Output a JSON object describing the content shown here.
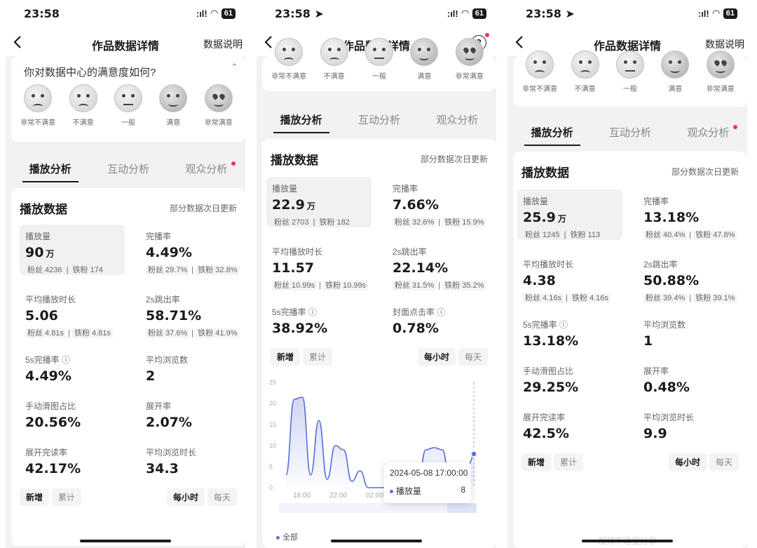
{
  "screens": [
    {
      "status_time": "23:58",
      "signal": ":ıl!",
      "battery": "61",
      "nav_title": "作品数据详情",
      "nav_help": "数据说明",
      "survey_question": "你对数据中心的满意度如何?",
      "emoji_labels": [
        "非常不满意",
        "不满意",
        "一般",
        "满意",
        "非常满意"
      ],
      "tabs": [
        "播放分析",
        "互动分析",
        "观众分析"
      ],
      "card_title": "播放数据",
      "card_note": "部分数据次日更新",
      "metrics": [
        {
          "label": "播放量",
          "value": "90",
          "unit": "万",
          "sub_fans": "粉丝 4236",
          "sub_iron": "铁粉 174"
        },
        {
          "label": "完播率",
          "value": "4.49%",
          "unit": "",
          "sub_fans": "粉丝 29.7%",
          "sub_iron": "铁粉 32.8%"
        },
        {
          "label": "平均播放时长",
          "value": "5.06",
          "unit": "",
          "sub_fans": "粉丝 4.81s",
          "sub_iron": "铁粉 4.81s"
        },
        {
          "label": "2s跳出率",
          "value": "58.71%",
          "unit": "",
          "sub_fans": "粉丝 37.6%",
          "sub_iron": "铁粉 41.9%"
        },
        {
          "label": "5s完播率 ⓘ",
          "value": "4.49%"
        },
        {
          "label": "平均浏览数",
          "value": "2"
        },
        {
          "label": "手动滑图占比",
          "value": "20.56%"
        },
        {
          "label": "展开率",
          "value": "2.07%"
        },
        {
          "label": "展开完读率",
          "value": "42.17%"
        },
        {
          "label": "平均浏览时长",
          "value": "34.3"
        }
      ],
      "buttons": {
        "new": "新增",
        "cumulative": "累计",
        "hourly": "每小时",
        "daily": "每天"
      }
    },
    {
      "status_time": "23:58",
      "signal": ":ıl!",
      "battery": "61",
      "nav_title": "作品数据详情",
      "nav_help_symbol": "?",
      "emoji_labels": [
        "非常不满意",
        "不满意",
        "一般",
        "满意",
        "非常满意"
      ],
      "tabs": [
        "播放分析",
        "互动分析",
        "观众分析"
      ],
      "card_title": "播放数据",
      "card_note": "部分数据次日更新",
      "metrics": [
        {
          "label": "播放量",
          "value": "22.9",
          "unit": "万",
          "sub_fans": "粉丝 2703",
          "sub_iron": "铁粉 182"
        },
        {
          "label": "完播率",
          "value": "7.66%",
          "unit": "",
          "sub_fans": "粉丝 32.6%",
          "sub_iron": "铁粉 15.9%"
        },
        {
          "label": "平均播放时长",
          "value": "11.57",
          "unit": "",
          "sub_fans": "粉丝 10.99s",
          "sub_iron": "铁粉 10.99s"
        },
        {
          "label": "2s跳出率",
          "value": "22.14%",
          "unit": "",
          "sub_fans": "粉丝 31.5%",
          "sub_iron": "铁粉 35.2%"
        },
        {
          "label": "5s完播率 ⓘ",
          "value": "38.92%"
        },
        {
          "label": "封面点击率 ⓘ",
          "value": "0.78%"
        }
      ],
      "buttons": {
        "new": "新增",
        "cumulative": "累计",
        "hourly": "每小时",
        "daily": "每天"
      },
      "tooltip": {
        "date": "2024-05-08 17:00:00",
        "series": "播放量",
        "value": "8"
      },
      "legend": "全部"
    },
    {
      "status_time": "23:58",
      "signal": ":ıl!",
      "battery": "61",
      "nav_title": "作品数据详情",
      "nav_help": "数据说明",
      "emoji_labels": [
        "非常不满意",
        "不满意",
        "一般",
        "满意",
        "非常满意"
      ],
      "tabs": [
        "播放分析",
        "互动分析",
        "观众分析"
      ],
      "card_title": "播放数据",
      "card_note": "部分数据次日更新",
      "metrics": [
        {
          "label": "播放量",
          "value": "25.9",
          "unit": "万",
          "sub_fans": "粉丝 1245",
          "sub_iron": "铁粉 113"
        },
        {
          "label": "完播率",
          "value": "13.18%",
          "unit": "",
          "sub_fans": "粉丝 40.4%",
          "sub_iron": "铁粉 47.8%"
        },
        {
          "label": "平均播放时长",
          "value": "4.38",
          "unit": "",
          "sub_fans": "粉丝 4.16s",
          "sub_iron": "铁粉 4.16s"
        },
        {
          "label": "2s跳出率",
          "value": "50.88%",
          "unit": "",
          "sub_fans": "粉丝 39.4%",
          "sub_iron": "铁粉 39.1%"
        },
        {
          "label": "5s完播率 ⓘ",
          "value": "13.18%"
        },
        {
          "label": "平均浏览数",
          "value": "1"
        },
        {
          "label": "手动滑图占比",
          "value": "29.25%"
        },
        {
          "label": "展开率",
          "value": "0.48%"
        },
        {
          "label": "展开完读率",
          "value": "42.5%"
        },
        {
          "label": "平均浏览时长",
          "value": "9.9"
        }
      ],
      "buttons": {
        "new": "新增",
        "cumulative": "累计",
        "hourly": "每小时",
        "daily": "每天"
      },
      "faded_text": "视频不适宜分享"
    }
  ],
  "chart_data": {
    "type": "area",
    "title": "",
    "xlabel": "",
    "ylabel": "",
    "x_ticks": [
      "18:00",
      "22:00",
      "02:00"
    ],
    "y_ticks": [
      0,
      5,
      10,
      15,
      20,
      25
    ],
    "ylim": [
      0,
      25
    ],
    "series": [
      {
        "name": "播放量",
        "x_hours": [
          0,
          1,
          2,
          3,
          4,
          5,
          6,
          7,
          8,
          9,
          10,
          11,
          12,
          13,
          14,
          15,
          16,
          17,
          18,
          19,
          20,
          21,
          22,
          23
        ],
        "values": [
          3,
          21,
          21.5,
          3,
          16,
          2,
          10,
          9,
          1.5,
          4,
          0,
          0,
          0,
          0,
          5,
          0,
          0,
          9,
          9.5,
          9,
          0,
          5,
          5,
          8
        ]
      }
    ],
    "highlight": {
      "date": "2024-05-08 17:00:00",
      "value": 8
    }
  }
}
